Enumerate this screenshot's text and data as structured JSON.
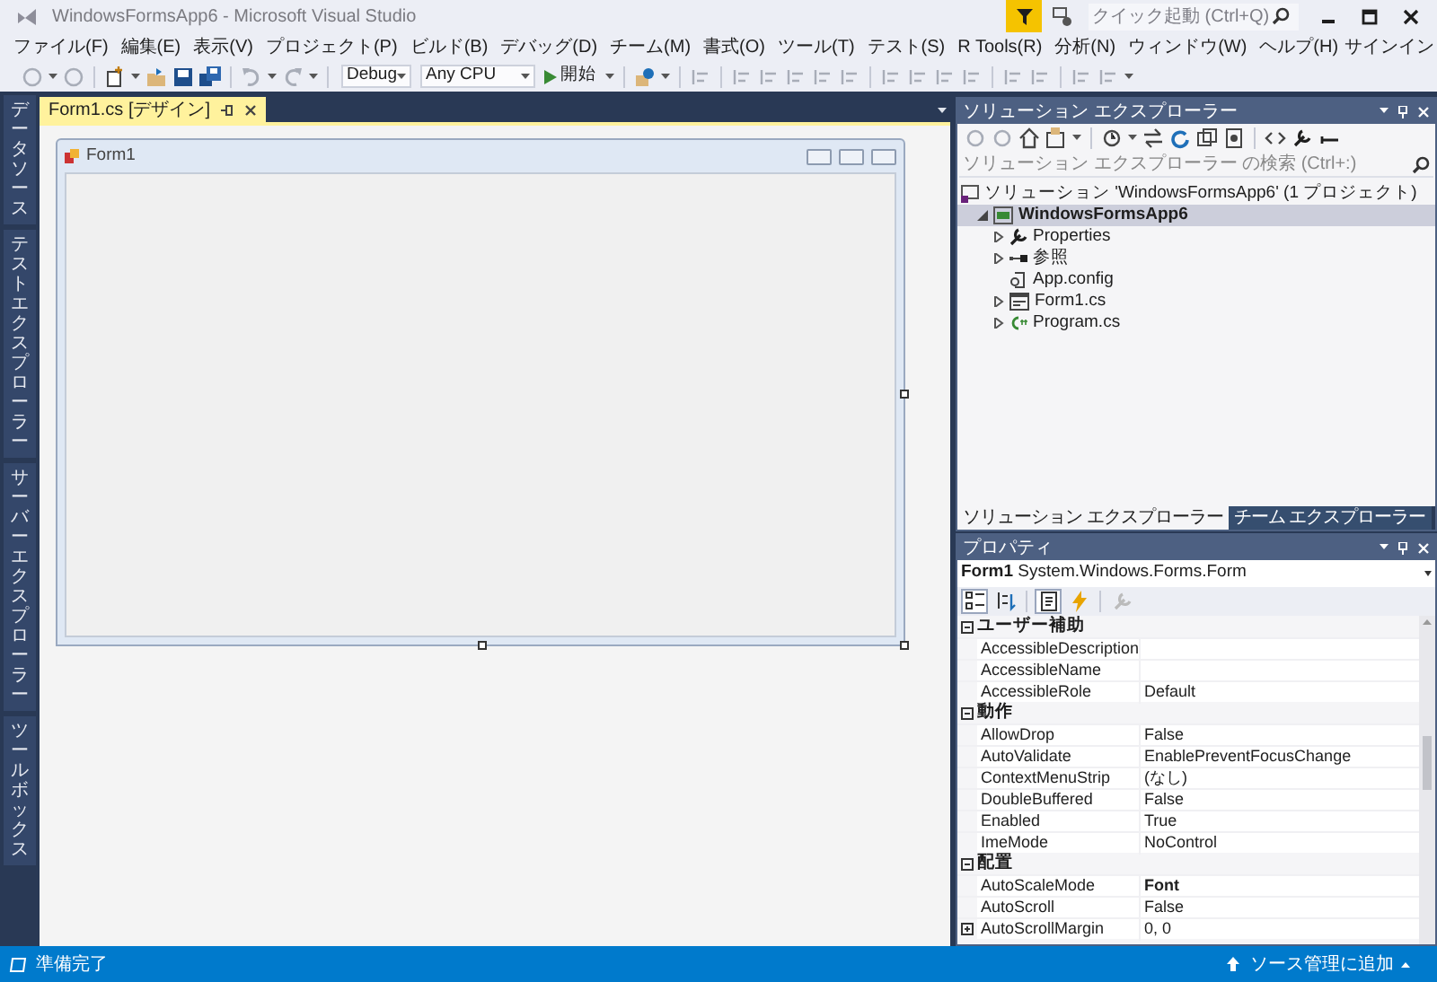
{
  "window": {
    "title": "WindowsFormsApp6 - Microsoft Visual Studio"
  },
  "quick_launch": {
    "placeholder": "クイック起動 (Ctrl+Q)"
  },
  "menu": [
    "ファイル(F)",
    "編集(E)",
    "表示(V)",
    "プロジェクト(P)",
    "ビルド(B)",
    "デバッグ(D)",
    "チーム(M)",
    "書式(O)",
    "ツール(T)",
    "テスト(S)",
    "R Tools(R)",
    "分析(N)",
    "ウィンドウ(W)",
    "ヘルプ(H)"
  ],
  "sign_in": "サインイン",
  "toolbar": {
    "configuration": "Debug",
    "platform": "Any CPU",
    "start": "開始"
  },
  "side_tabs": [
    "データソース",
    "テストエクスプローラー",
    "サーバーエクスプローラー",
    "ツールボックス"
  ],
  "document_tabs": [
    {
      "label": "Form1.cs [デザイン]",
      "selected": true
    }
  ],
  "designer": {
    "form_title": "Form1"
  },
  "solution_explorer": {
    "title": "ソリューション エクスプローラー",
    "search_placeholder": "ソリューション エクスプローラー の検索 (Ctrl+:)",
    "tree": [
      {
        "label": "ソリューション 'WindowsFormsApp6' (1 プロジェクト)",
        "kind": "solution",
        "selected": false,
        "children": [
          {
            "label": "WindowsFormsApp6",
            "kind": "project",
            "expanded": true,
            "selected": true,
            "children": [
              {
                "label": "Properties",
                "kind": "properties",
                "expanded": false,
                "selected": false
              },
              {
                "label": "参照",
                "kind": "references",
                "expanded": false,
                "selected": false
              },
              {
                "label": "App.config",
                "kind": "config",
                "selected": false
              },
              {
                "label": "Form1.cs",
                "kind": "form",
                "expanded": false,
                "selected": false
              },
              {
                "label": "Program.cs",
                "kind": "code",
                "expanded": false,
                "selected": false
              }
            ]
          }
        ]
      }
    ],
    "tabs": [
      {
        "label": "ソリューション エクスプローラー",
        "selected": true
      },
      {
        "label": "チーム エクスプローラー",
        "selected": false
      }
    ]
  },
  "properties": {
    "title": "プロパティ",
    "object": "**Form1** System.Windows.Forms.Form",
    "toolbar": [
      {
        "kind": "categorized",
        "pressed": true
      },
      {
        "kind": "alphabetical",
        "pressed": false
      },
      {
        "kind": "properties",
        "pressed": true
      },
      {
        "kind": "events",
        "pressed": false
      },
      {
        "kind": "property-pages",
        "pressed": false
      }
    ],
    "rows": [
      {
        "kind": "category",
        "name": "ユーザー補助",
        "expanded": true
      },
      {
        "kind": "property",
        "name": "AccessibleDescription",
        "expandable": false
      },
      {
        "kind": "property",
        "name": "AccessibleName",
        "expandable": false
      },
      {
        "kind": "property",
        "name": "AccessibleRole",
        "value": "Default",
        "modified": false,
        "expandable": false
      },
      {
        "kind": "category",
        "name": "動作",
        "expanded": true
      },
      {
        "kind": "property",
        "name": "AllowDrop",
        "value": "False",
        "modified": false,
        "expandable": false
      },
      {
        "kind": "property",
        "name": "AutoValidate",
        "value": "EnablePreventFocusChange",
        "modified": false,
        "expandable": false
      },
      {
        "kind": "property",
        "name": "ContextMenuStrip",
        "value": "(なし)",
        "modified": false,
        "expandable": false
      },
      {
        "kind": "property",
        "name": "DoubleBuffered",
        "value": "False",
        "modified": false,
        "expandable": false
      },
      {
        "kind": "property",
        "name": "Enabled",
        "value": "True",
        "modified": false,
        "expandable": false
      },
      {
        "kind": "property",
        "name": "ImeMode",
        "value": "NoControl",
        "modified": false,
        "expandable": false
      },
      {
        "kind": "category",
        "name": "配置",
        "expanded": true
      },
      {
        "kind": "property",
        "name": "AutoScaleMode",
        "value": "Font",
        "modified": true,
        "expandable": false
      },
      {
        "kind": "property",
        "name": "AutoScroll",
        "value": "False",
        "modified": false,
        "expandable": false
      },
      {
        "kind": "property",
        "name": "AutoScrollMargin",
        "value": "0, 0",
        "modified": false,
        "expandable": true
      }
    ]
  },
  "status_bar": {
    "message": "準備完了",
    "source_control": "ソース管理に追加"
  }
}
